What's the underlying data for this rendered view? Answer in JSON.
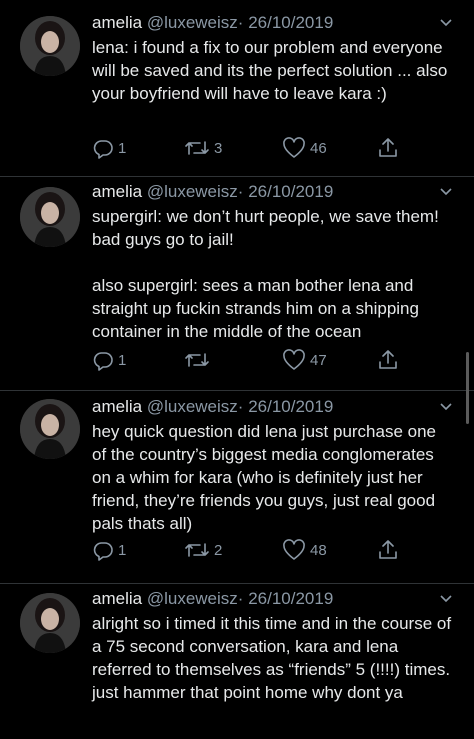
{
  "tweets": [
    {
      "name": "amelia",
      "handle": "@luxeweisz",
      "separator": "·",
      "date": "26/10/2019",
      "text": "lena: i found a fix to our problem and everyone will be saved and its the perfect solution ... also your boyfriend will have to leave kara :)",
      "replies": "1",
      "retweets": "3",
      "likes": "46"
    },
    {
      "name": "amelia",
      "handle": "@luxeweisz",
      "separator": "·",
      "date": "26/10/2019",
      "text": "supergirl: we don’t hurt people, we save them! bad guys go to jail!\n\nalso supergirl: sees a man bother lena and straight up fuckin strands him on a shipping container in the middle of the ocean",
      "replies": "1",
      "retweets": "",
      "likes": "47"
    },
    {
      "name": "amelia",
      "handle": "@luxeweisz",
      "separator": "·",
      "date": "26/10/2019",
      "text": "hey quick question did lena just purchase one of the country’s biggest media conglomerates on a whim for kara (who is definitely just her friend, they’re friends you guys, just real good pals thats all)",
      "replies": "1",
      "retweets": "2",
      "likes": "48"
    },
    {
      "name": "amelia",
      "handle": "@luxeweisz",
      "separator": "·",
      "date": "26/10/2019",
      "text": "alright so i timed it this time and in the course of a 75 second conversation, kara and lena referred to themselves as “friends” 5 (!!!!) times. just hammer that point home why dont ya",
      "replies": "",
      "retweets": "",
      "likes": ""
    }
  ],
  "icons": {
    "reply": "reply-icon",
    "retweet": "retweet-icon",
    "like": "heart-icon",
    "share": "share-icon",
    "more": "chevron-down-icon"
  },
  "colors": {
    "background": "#000000",
    "text": "#e7e9ea",
    "muted": "#8b98a5",
    "divider": "#2f3336"
  }
}
